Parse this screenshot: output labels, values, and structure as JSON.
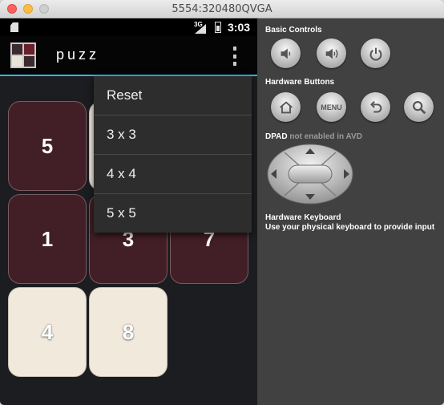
{
  "window": {
    "title": "5554:320480QVGA"
  },
  "statusbar": {
    "network": "3G",
    "time": "3:03"
  },
  "actionbar": {
    "title": "puzz"
  },
  "tiles": [
    {
      "label": "5",
      "style": "dark"
    },
    {
      "label": "",
      "style": "light"
    },
    {
      "label": "1",
      "style": "dark"
    },
    {
      "label": "3",
      "style": "dark"
    },
    {
      "label": "7",
      "style": "dark"
    },
    {
      "label": "4",
      "style": "light"
    },
    {
      "label": "8",
      "style": "light"
    }
  ],
  "menu": {
    "items": [
      "Reset",
      "3 x 3",
      "4 x 4",
      "5 x 5"
    ]
  },
  "panel": {
    "basic_controls": "Basic Controls",
    "hardware_buttons": "Hardware Buttons",
    "menu_button_label": "MENU",
    "dpad_label": "DPAD",
    "dpad_note": "not enabled in AVD",
    "keyboard_title": "Hardware Keyboard",
    "keyboard_note": "Use your physical keyboard to provide input"
  },
  "colors": {
    "accent": "#33b5e5",
    "tile_dark": "#421e27",
    "tile_light": "#f1e9dc",
    "menu_bg": "#2d2d2d",
    "panel_bg": "#414141"
  }
}
